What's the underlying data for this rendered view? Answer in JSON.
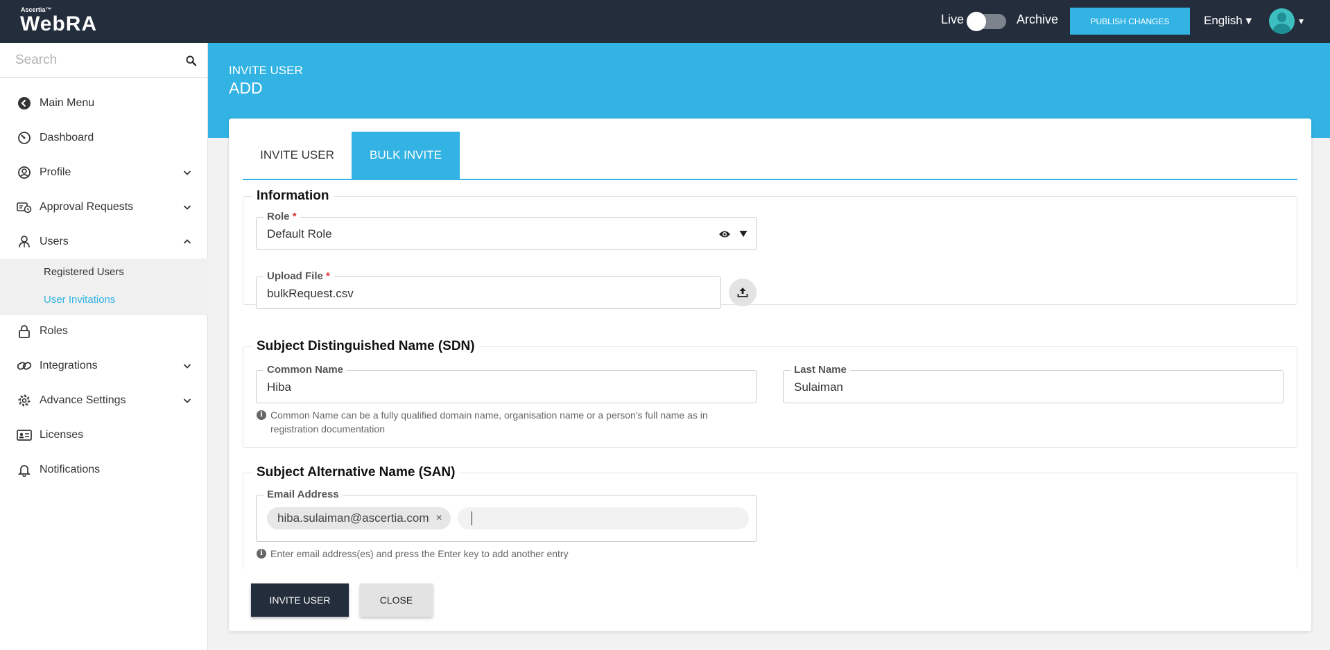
{
  "header": {
    "logo_small": "Ascertia™",
    "logo": "WebRA",
    "live_label": "Live",
    "archive_label": "Archive",
    "publish_label": "PUBLISH CHANGES",
    "language": "English ▾",
    "avatar_caret": "▾"
  },
  "sidebar": {
    "search_placeholder": "Search",
    "items": [
      {
        "label": "Main Menu",
        "icon": "back-circle-icon"
      },
      {
        "label": "Dashboard",
        "icon": "dashboard-gauge-icon"
      },
      {
        "label": "Profile",
        "icon": "user-circle-icon",
        "chevron": "down"
      },
      {
        "label": "Approval Requests",
        "icon": "approval-requests-icon",
        "chevron": "down"
      },
      {
        "label": "Users",
        "icon": "users-icon",
        "chevron": "up"
      },
      {
        "label": "Roles",
        "icon": "lock-icon"
      },
      {
        "label": "Integrations",
        "icon": "link-icon",
        "chevron": "down"
      },
      {
        "label": "Advance Settings",
        "icon": "gear-icon",
        "chevron": "down"
      },
      {
        "label": "Licenses",
        "icon": "license-card-icon"
      },
      {
        "label": "Notifications",
        "icon": "bell-icon"
      }
    ],
    "subitems": [
      {
        "label": "Registered Users",
        "active": false
      },
      {
        "label": "User Invitations",
        "active": true
      }
    ]
  },
  "banner": {
    "subtitle": "INVITE USER",
    "title": "ADD"
  },
  "tabs": [
    {
      "label": "INVITE USER",
      "active": false
    },
    {
      "label": "BULK INVITE",
      "active": true
    }
  ],
  "sections": {
    "information": {
      "title": "Information",
      "role": {
        "label": "Role",
        "required": "*",
        "value": "Default Role"
      },
      "upload": {
        "label": "Upload File",
        "required": "*",
        "value": "bulkRequest.csv"
      }
    },
    "sdn": {
      "title": "Subject Distinguished Name (SDN)",
      "common_name": {
        "label": "Common Name",
        "value": "Hiba"
      },
      "last_name": {
        "label": "Last Name",
        "value": "Sulaiman"
      },
      "help": "Common Name can be a fully qualified domain name, organisation name or a person's full name as in registration documentation"
    },
    "san": {
      "title": "Subject Alternative Name (SAN)",
      "email": {
        "label": "Email Address",
        "chip": "hiba.sulaiman@ascertia.com",
        "chip_remove": "×"
      },
      "help": "Enter email address(es) and press the Enter key to add another entry"
    }
  },
  "actions": {
    "invite_label": "INVITE USER",
    "close_label": "CLOSE"
  },
  "colors": {
    "accent": "#32b3e3",
    "header_bg": "#232d3b",
    "required": "#dd3333"
  }
}
